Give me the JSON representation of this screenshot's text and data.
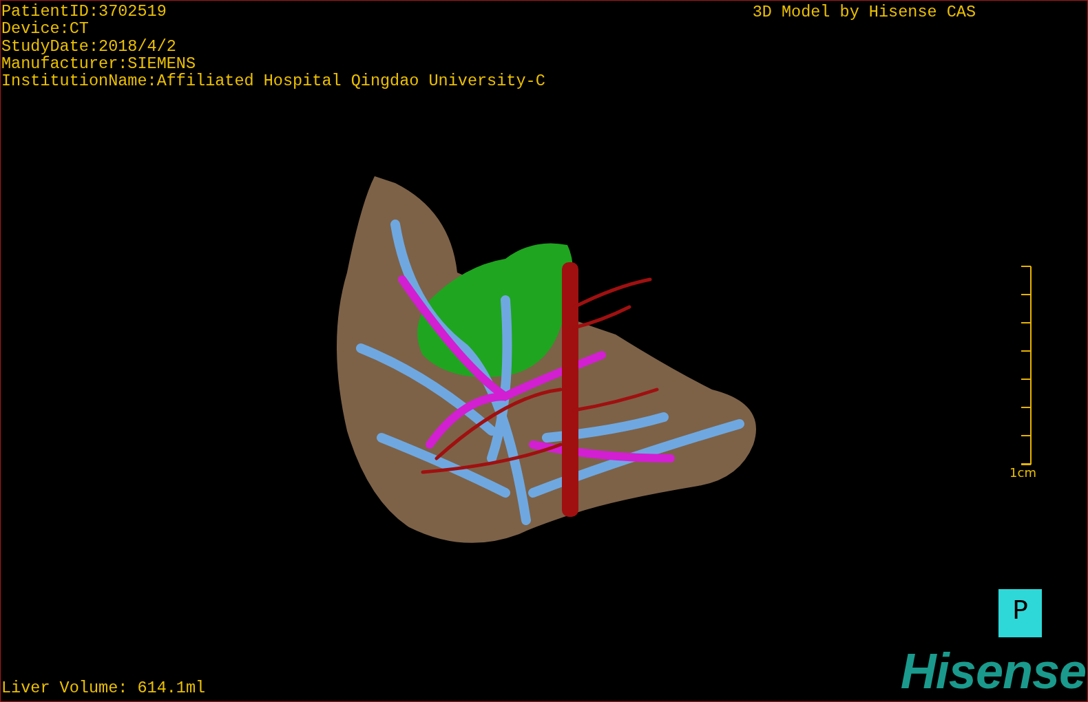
{
  "patient_info": [
    "PatientID:3702519",
    "Device:CT",
    "StudyDate:2018/4/2",
    "Manufacturer:SIEMENS",
    "InstitutionName:Affiliated Hospital Qingdao University-C"
  ],
  "model_credit": "3D Model by Hisense CAS",
  "scale_bar": {
    "label": "1cm"
  },
  "orientation": {
    "label": "P"
  },
  "logo": "Hisense",
  "liver_volume": "Liver Volume: 614.1ml"
}
